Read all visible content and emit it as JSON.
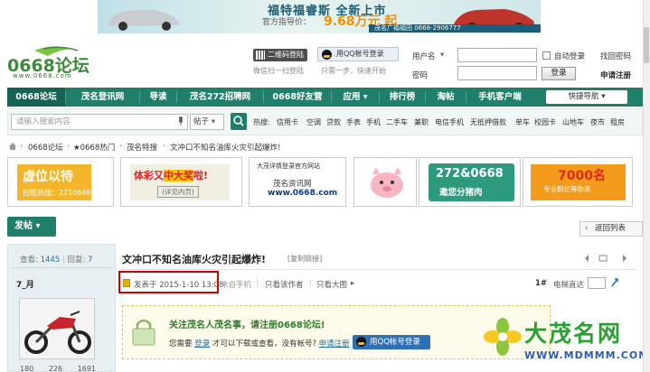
{
  "top_ad": {
    "title": "福特福睿斯 全新上市",
    "price_label": "官方指导价：",
    "price": "9.68万元 起",
    "strip": "茂名广福福田   0668-2906777"
  },
  "logo": {
    "brand": "0668论坛",
    "domain": "www.0668.com"
  },
  "header": {
    "qr_login": "二维码登陆",
    "qr_sub": "微信扫一扫登陆",
    "qq_login": "用QQ帐号登录",
    "qq_sub": "只需一步，快速开始",
    "username_label": "用户名",
    "password_label": "密码",
    "auto_login": "自动登录",
    "forgot": "找回密码",
    "login_btn": "登录",
    "register": "申请注册"
  },
  "nav": {
    "items": [
      "0668论坛",
      "茂名登讯网",
      "导读",
      "茂名272招聘网",
      "0668好友营",
      "应用 ▾",
      "排行榜",
      "淘帖",
      "手机客户端"
    ],
    "quick_nav": "快捷导航 ▾"
  },
  "search": {
    "placeholder": "请输入搜索内容",
    "type": "帖子",
    "hot_label": "热搜:",
    "hot": [
      "信用卡",
      "空调",
      "贷款",
      "手表",
      "手机",
      "二手车",
      "兼职",
      "电信手机",
      "无抵押借款",
      "单车",
      "校园卡",
      "山地车",
      "夜市",
      "租房"
    ]
  },
  "breadcrumb": [
    "0668论坛",
    "★0668热门",
    "茂名特搜",
    "文冲口不知名油库火灾引起爆炸!"
  ],
  "ads": {
    "ad1_title": "虚位以待",
    "ad1_sub": "招租热线：2210668",
    "ad2_title_a": "体彩又",
    "ad2_title_b": "中大奖",
    "ad2_title_c": "啦!",
    "ad2_sub": "(详见内页)",
    "ad3_l1": "大茂详情登录官方网站",
    "ad3_l2": "茂名资讯网",
    "ad3_l3": "www.0668.com",
    "ad5_title": "272&0668",
    "ad5_sub": "邀您分猪肉",
    "ad6_title": "7000名",
    "ad6_sub": "专业职位等你来"
  },
  "post_btn": "发帖 ▾",
  "back_btn": "返回列表",
  "post": {
    "views_label": "查看:",
    "views": "1445",
    "replies_label": "回复:",
    "replies": "7",
    "author": "7_月",
    "title": "文冲口不知名油库火灾引起爆炸!",
    "copy_link": "[复制链接]",
    "posted_on": "发表于 2015-1-10 13:08",
    "from_mobile": "来自手机",
    "only_author": "只看该作者",
    "big_image": "只看大图",
    "floor": "1#",
    "jump": "电梯直达",
    "bottom_stats": [
      "180",
      "226",
      "1691"
    ]
  },
  "notice": {
    "title": "关注茂名人茂名事，请注册0668论坛!",
    "text_a": "您需要",
    "login_link": "登录",
    "text_b": "才可以下载或查看，没有帐号?",
    "register_link": "申请注册",
    "qq_btn": "用QQ帐号登录"
  },
  "watermark": {
    "text": "大茂名网",
    "url": "WWW.MDMMM.COM"
  }
}
